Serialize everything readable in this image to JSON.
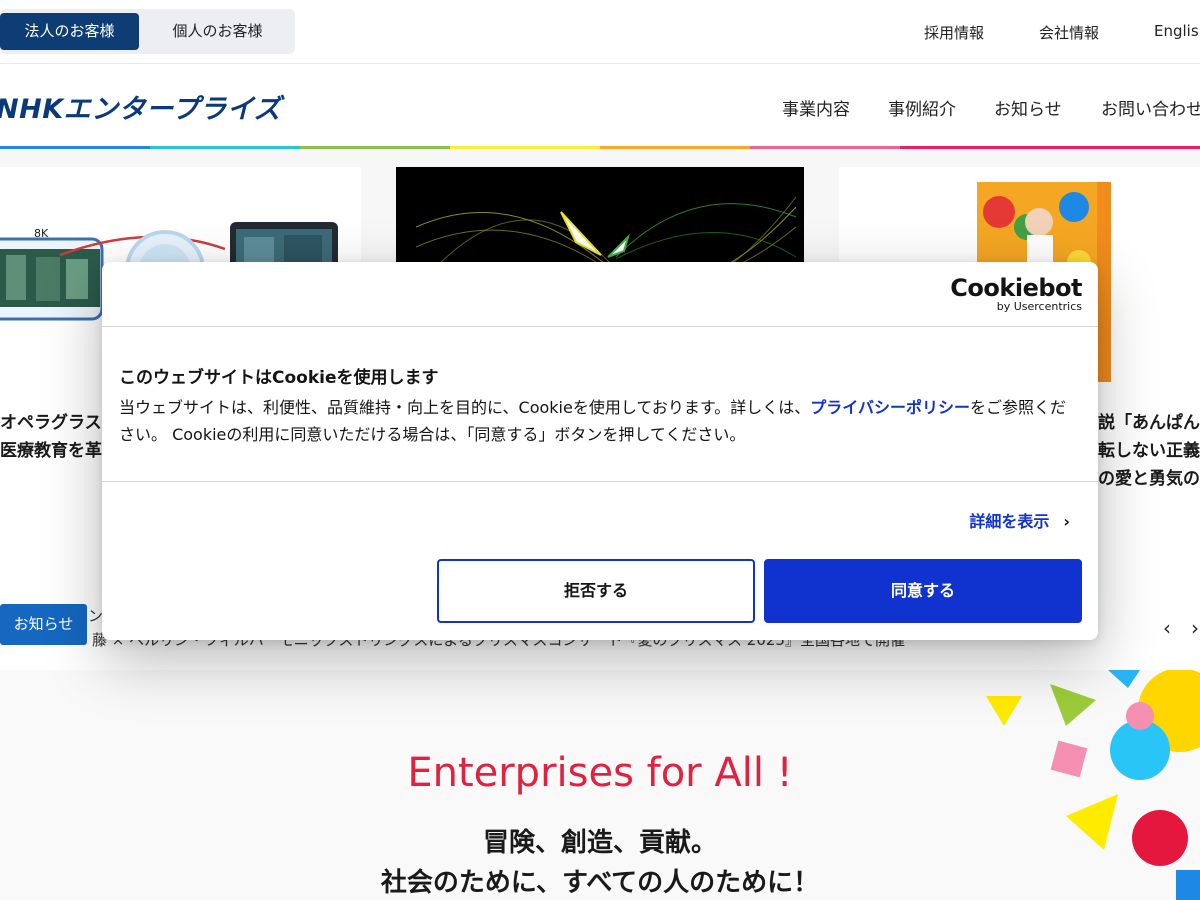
{
  "topbar": {
    "segments": [
      "法人のお客様",
      "個人のお客様"
    ],
    "links": [
      "採用情報",
      "会社情報",
      "English"
    ]
  },
  "header": {
    "logo": "NHKエンタープライズ",
    "nav": [
      "事業内容",
      "事例紹介",
      "お知らせ",
      "お問い合わせ"
    ]
  },
  "cards": [
    {
      "line1": "オペラグラス",
      "line2": "医療教育を革新",
      "img_label": "8K"
    },
    {
      "line1": "",
      "line2": ""
    },
    {
      "line1": "説「あんぱん」",
      "line2": "転しない正義",
      "line3": "の愛と勇気の物"
    }
  ],
  "news": {
    "badge": "お知らせ",
    "text_partial": "ン",
    "text": "藤 × ベルリン・フィルハーモニックストリングスによるクリスマスコンサート『愛のクリスマス 2025』全国各地で開催",
    "prev": "‹",
    "next": "›"
  },
  "hero": {
    "title": "Enterprises for All !",
    "line1": "冒険、創造、貢献。",
    "line2": "社会のために、すべての人のために！"
  },
  "cookie": {
    "brand": "Cookiebot",
    "brand_sub": "by Usercentrics",
    "title": "このウェブサイトはCookieを使用します",
    "body_pre": "当ウェブサイトは、利便性、品質維持・向上を目的に、Cookieを使用しております。詳しくは、",
    "body_link": "プライバシーポリシー",
    "body_post": "をご参照ください。 Cookieの利用に同意いただける場合は、「同意する」ボタンを押してください。",
    "details": "詳細を表示",
    "decline": "拒否する",
    "accept": "同意する"
  },
  "colors": {
    "accent": "#1032cf",
    "brand": "#0b3a78",
    "hero_title": "#e0213f",
    "news_badge": "#1567c0"
  }
}
